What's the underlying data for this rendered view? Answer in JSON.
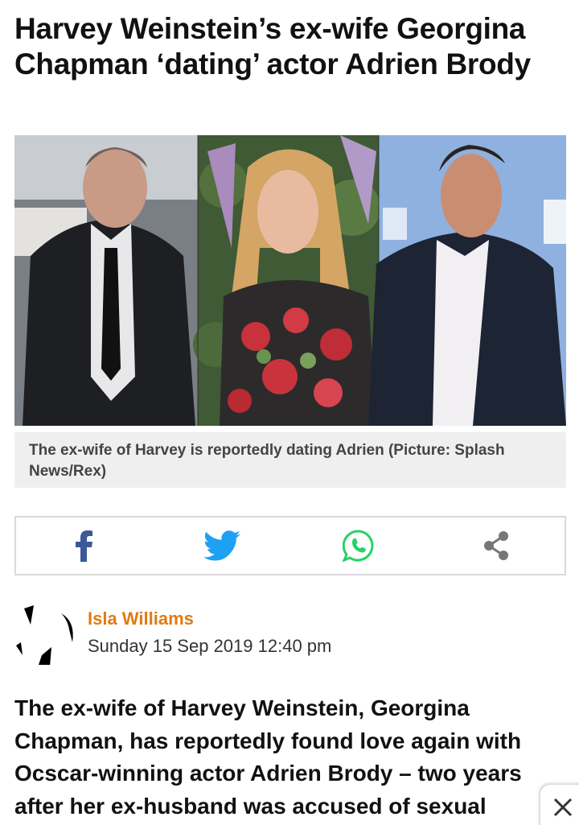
{
  "article": {
    "headline": "Harvey Weinstein’s ex-wife Georgina Chapman ‘dating’ actor Adrien Brody",
    "image_caption": "The ex-wife of Harvey is reportedly dating Adrien (Picture: Splash News/Rex)",
    "author": "Isla Williams",
    "date": "Sunday 15 Sep 2019 12:40 pm",
    "lead": "The ex-wife of Harvey Weinstein, Georgina Chapman, has reportedly found love again with Ocscar-winning actor Adrien Brody – two years after her ex-husband was accused of sexual"
  },
  "share": {
    "buttons": [
      {
        "icon": "facebook-icon",
        "color": "#3b5998"
      },
      {
        "icon": "twitter-icon",
        "color": "#1da1f2"
      },
      {
        "icon": "whatsapp-icon",
        "color": "#25d366"
      },
      {
        "icon": "share-icon",
        "color": "#777777"
      }
    ]
  },
  "colors": {
    "author": "#e07a12",
    "caption_bg": "#efefef"
  },
  "close_icon": "close-icon"
}
